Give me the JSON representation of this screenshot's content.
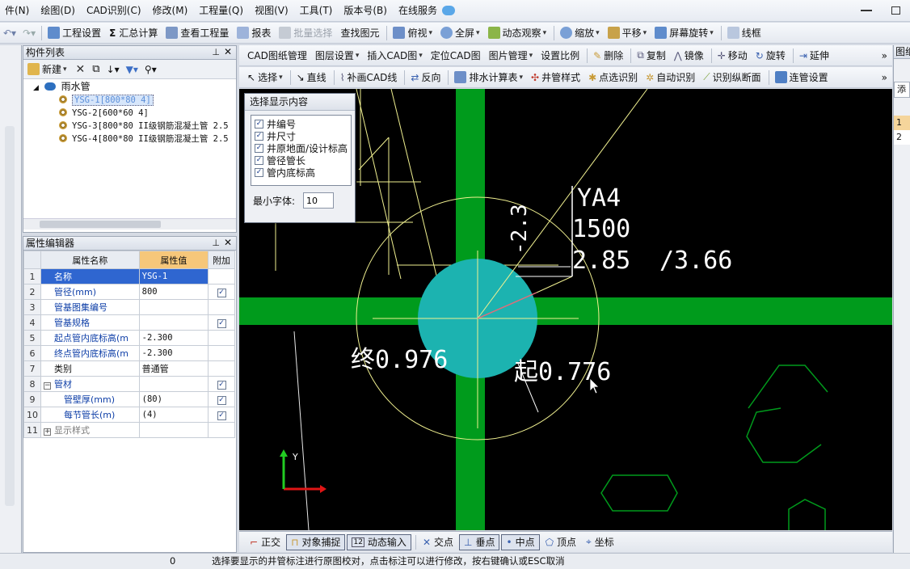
{
  "menu": [
    "件(N)",
    "绘图(D)",
    "CAD识别(C)",
    "修改(M)",
    "工程量(Q)",
    "视图(V)",
    "工具(T)",
    "版本号(B)",
    "在线服务"
  ],
  "toolbar1": {
    "project_settings": "工程设置",
    "summary_calc": "汇总计算",
    "view_quantity": "查看工程量",
    "report": "报表",
    "batch_select": "批量选择",
    "find_element": "查找图元",
    "top_view": "俯视",
    "fullscreen": "全屏",
    "dynamic_view": "动态观察",
    "zoom": "缩放",
    "pan": "平移",
    "screen_rotate": "屏幕旋转",
    "wireframe": "线框"
  },
  "component_list": {
    "title": "构件列表",
    "new_label": "新建",
    "root": "雨水管",
    "items": [
      "YSG-1[800*80  4]",
      "YSG-2[600*60  4]",
      "YSG-3[800*80 II级钢筋混凝土管 2.5",
      "YSG-4[800*80 II级钢筋混凝土管 2.5"
    ]
  },
  "property_editor": {
    "title": "属性编辑器",
    "headers": [
      "属性名称",
      "属性值",
      "附加"
    ],
    "rows": [
      {
        "no": "1",
        "name": "名称",
        "value": "YSG-1"
      },
      {
        "no": "2",
        "name": "管径(mm)",
        "value": "800"
      },
      {
        "no": "3",
        "name": "管基图集编号",
        "value": ""
      },
      {
        "no": "4",
        "name": "管基规格",
        "value": ""
      },
      {
        "no": "5",
        "name": "起点管内底标高(m",
        "value": "-2.300"
      },
      {
        "no": "6",
        "name": "终点管内底标高(m",
        "value": "-2.300"
      },
      {
        "no": "7",
        "name": "类别",
        "value": "普通管"
      },
      {
        "no": "8",
        "name": "管材",
        "value": ""
      },
      {
        "no": "9",
        "name": "管壁厚(mm)",
        "value": "(80)"
      },
      {
        "no": "10",
        "name": "每节管长(m)",
        "value": "(4)"
      },
      {
        "no": "11",
        "name": "显示样式",
        "value": ""
      }
    ]
  },
  "cad_toolbar1": {
    "cad_drawing_mgmt": "CAD图纸管理",
    "layer_settings": "图层设置",
    "insert_cad": "插入CAD图",
    "locate_cad": "定位CAD图",
    "image_mgmt": "图片管理",
    "set_scale": "设置比例",
    "delete": "删除",
    "copy": "复制",
    "mirror": "镜像",
    "move": "移动",
    "rotate": "旋转",
    "extend": "延伸"
  },
  "cad_toolbar2": {
    "select": "选择",
    "line": "直线",
    "redraw_cad_line": "补画CAD线",
    "reverse": "反向",
    "drainage_calc": "排水计算表",
    "well_style": "井管样式",
    "point_identify": "点选识别",
    "auto_identify": "自动识别",
    "identify_profile": "识别纵断面",
    "pipe_settings": "连管设置"
  },
  "canvas": {
    "well_id": "YA4",
    "well_size": "1500",
    "ground_elev": "2.85",
    "design_elev": "/3.66",
    "end_text": "终0.976",
    "start_text": "起0.776",
    "vertical_text": "-2.3",
    "axis_y": "Y"
  },
  "dialog": {
    "title": "选择显示内容",
    "options": [
      "井编号",
      "井尺寸",
      "井原地面/设计标高",
      "管径管长",
      "管内底标高"
    ],
    "min_font_label": "最小字体:",
    "min_font_value": "10"
  },
  "snapbar": [
    "正交",
    "对象捕捉",
    "动态输入",
    "交点",
    "垂点",
    "中点",
    "顶点",
    "坐标"
  ],
  "right_panel": {
    "title": "图纸",
    "cells": [
      "添",
      "1",
      "2"
    ]
  },
  "status": {
    "count": "0",
    "message": "选择要显示的井管标注进行原图校对，点击标注可以进行修改，按右键确认或ESC取消"
  },
  "colors": {
    "pipe_green": "#009b1c",
    "well_cyan": "#1cb3b0",
    "cad_yellow": "#f0f090",
    "selection_blue": "#2f66d0"
  }
}
